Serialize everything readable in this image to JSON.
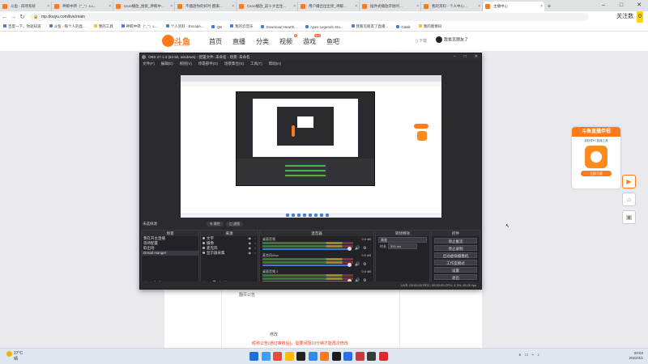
{
  "browser": {
    "tabs": [
      {
        "label": "斗鱼 - 四项系统",
        "active": false
      },
      {
        "label": "神鲸中转（\"_\"）Lu...",
        "active": false
      },
      {
        "label": "csoo播放_搜索_神鲸中...",
        "active": false
      },
      {
        "label": "不播放你的好时·醒来...",
        "active": false
      },
      {
        "label": "Csoo播放_前十大出生...",
        "active": false
      },
      {
        "label": "用户播出出出状_神鲸...",
        "active": false
      },
      {
        "label": "插件式播放开始时...",
        "active": false
      },
      {
        "label": "我的资料 - 个人中心...",
        "active": false
      },
      {
        "label": "主播中心",
        "active": true
      }
    ],
    "url": "mp.douyu.com/live/main",
    "follow_label": "关注数",
    "follow_count": "0",
    "bookmarks": [
      {
        "label": "百度一下，你就知道",
        "folder": false
      },
      {
        "label": "斗鱼 - 每个人的直...",
        "folder": false
      },
      {
        "label": "我的工具",
        "folder": true
      },
      {
        "label": "神鲸中转（\"_\"）L...",
        "folder": false
      },
      {
        "label": "个人资料 - Escape...",
        "folder": false
      },
      {
        "label": "QB",
        "folder": false
      },
      {
        "label": "我的云音乐",
        "folder": false
      },
      {
        "label": "Download Hearth...",
        "folder": false
      },
      {
        "label": "Apex Legends Sta...",
        "folder": false
      },
      {
        "label": "我看见朋友了直播...",
        "folder": false
      },
      {
        "label": "Gitalk",
        "folder": false
      },
      {
        "label": "我的图像码",
        "folder": true
      }
    ]
  },
  "douyu": {
    "logo_text": "斗鱼",
    "logo_sub": "DOUYU.COM",
    "nav": [
      {
        "label": "首页",
        "hot": ""
      },
      {
        "label": "直播",
        "hot": ""
      },
      {
        "label": "分类",
        "hot": ""
      },
      {
        "label": "视频",
        "hot": "8"
      },
      {
        "label": "游戏",
        "hot": "new"
      },
      {
        "label": "鱼吧",
        "hot": ""
      }
    ],
    "download_label": "下载",
    "username": "我看见朋友了"
  },
  "page": {
    "text1": "翻页公告",
    "text2": "修改",
    "notice": "昵称公告(通过审核后)，需要间隔10分钟才能再次修改"
  },
  "promo": {
    "title": "斗鱼直播伴侣",
    "desc": "超轻便PC直播工具",
    "button": "立即下载"
  },
  "obs": {
    "title": "OBS 27.1.3 (64-bit, windows) - 配置文件: 未命名 - 场景: 未命名",
    "menus": [
      "文件(F)",
      "编辑(E)",
      "视图(V)",
      "停靠部件(D)",
      "场景集合(S)",
      "工具(T)",
      "帮助(H)"
    ],
    "scene_label": "未选择源",
    "scene_props": "属性",
    "scene_filters": "滤镜",
    "docks": {
      "scenes": {
        "title": "场景",
        "items": [
          "我在开主直播",
          "等待配置",
          "取出场",
          "Dread Hunger"
        ]
      },
      "sources": {
        "title": "来源",
        "items": [
          "文字",
          "摄像",
          "麦克风",
          "显示器采集"
        ]
      },
      "mixer": {
        "title": "混音器",
        "channels": [
          {
            "label": "桌面音频",
            "value": "0.0 dB"
          },
          {
            "label": "麦克风/Aux",
            "value": "0.0 dB"
          },
          {
            "label": "桌面音频 2",
            "value": "0.0 dB"
          }
        ]
      },
      "transitions": {
        "title": "转场特效",
        "selected": "渐变",
        "duration_label": "时长",
        "duration": "300 ms"
      },
      "controls": {
        "title": "控件",
        "buttons": [
          "停止推流",
          "停止录制",
          "启动虚拟摄像机",
          "工作室模式",
          "设置",
          "退出"
        ]
      }
    },
    "status": "LIVE: 00:00:00   REC: 00:00:00   CPU: 1.3%, 60.00 fps"
  },
  "taskbar": {
    "weather": "27°C",
    "weather_desc": "晴",
    "time": "20:03",
    "date": "2022/4/1",
    "icon_colors": [
      "#1e6fd9",
      "#3aa0ff",
      "#e84b3a",
      "#fbbc05",
      "#222222",
      "#2d8cf0",
      "#ff7a1a",
      "#1c1c1c",
      "#2a6ee8",
      "#c93a3a",
      "#3b3b3b",
      "#d92b2b"
    ]
  },
  "colors": {
    "accent": "#ff7a1a",
    "obs_bg": "#2b2b2f",
    "notice": "#ff3a1a"
  }
}
